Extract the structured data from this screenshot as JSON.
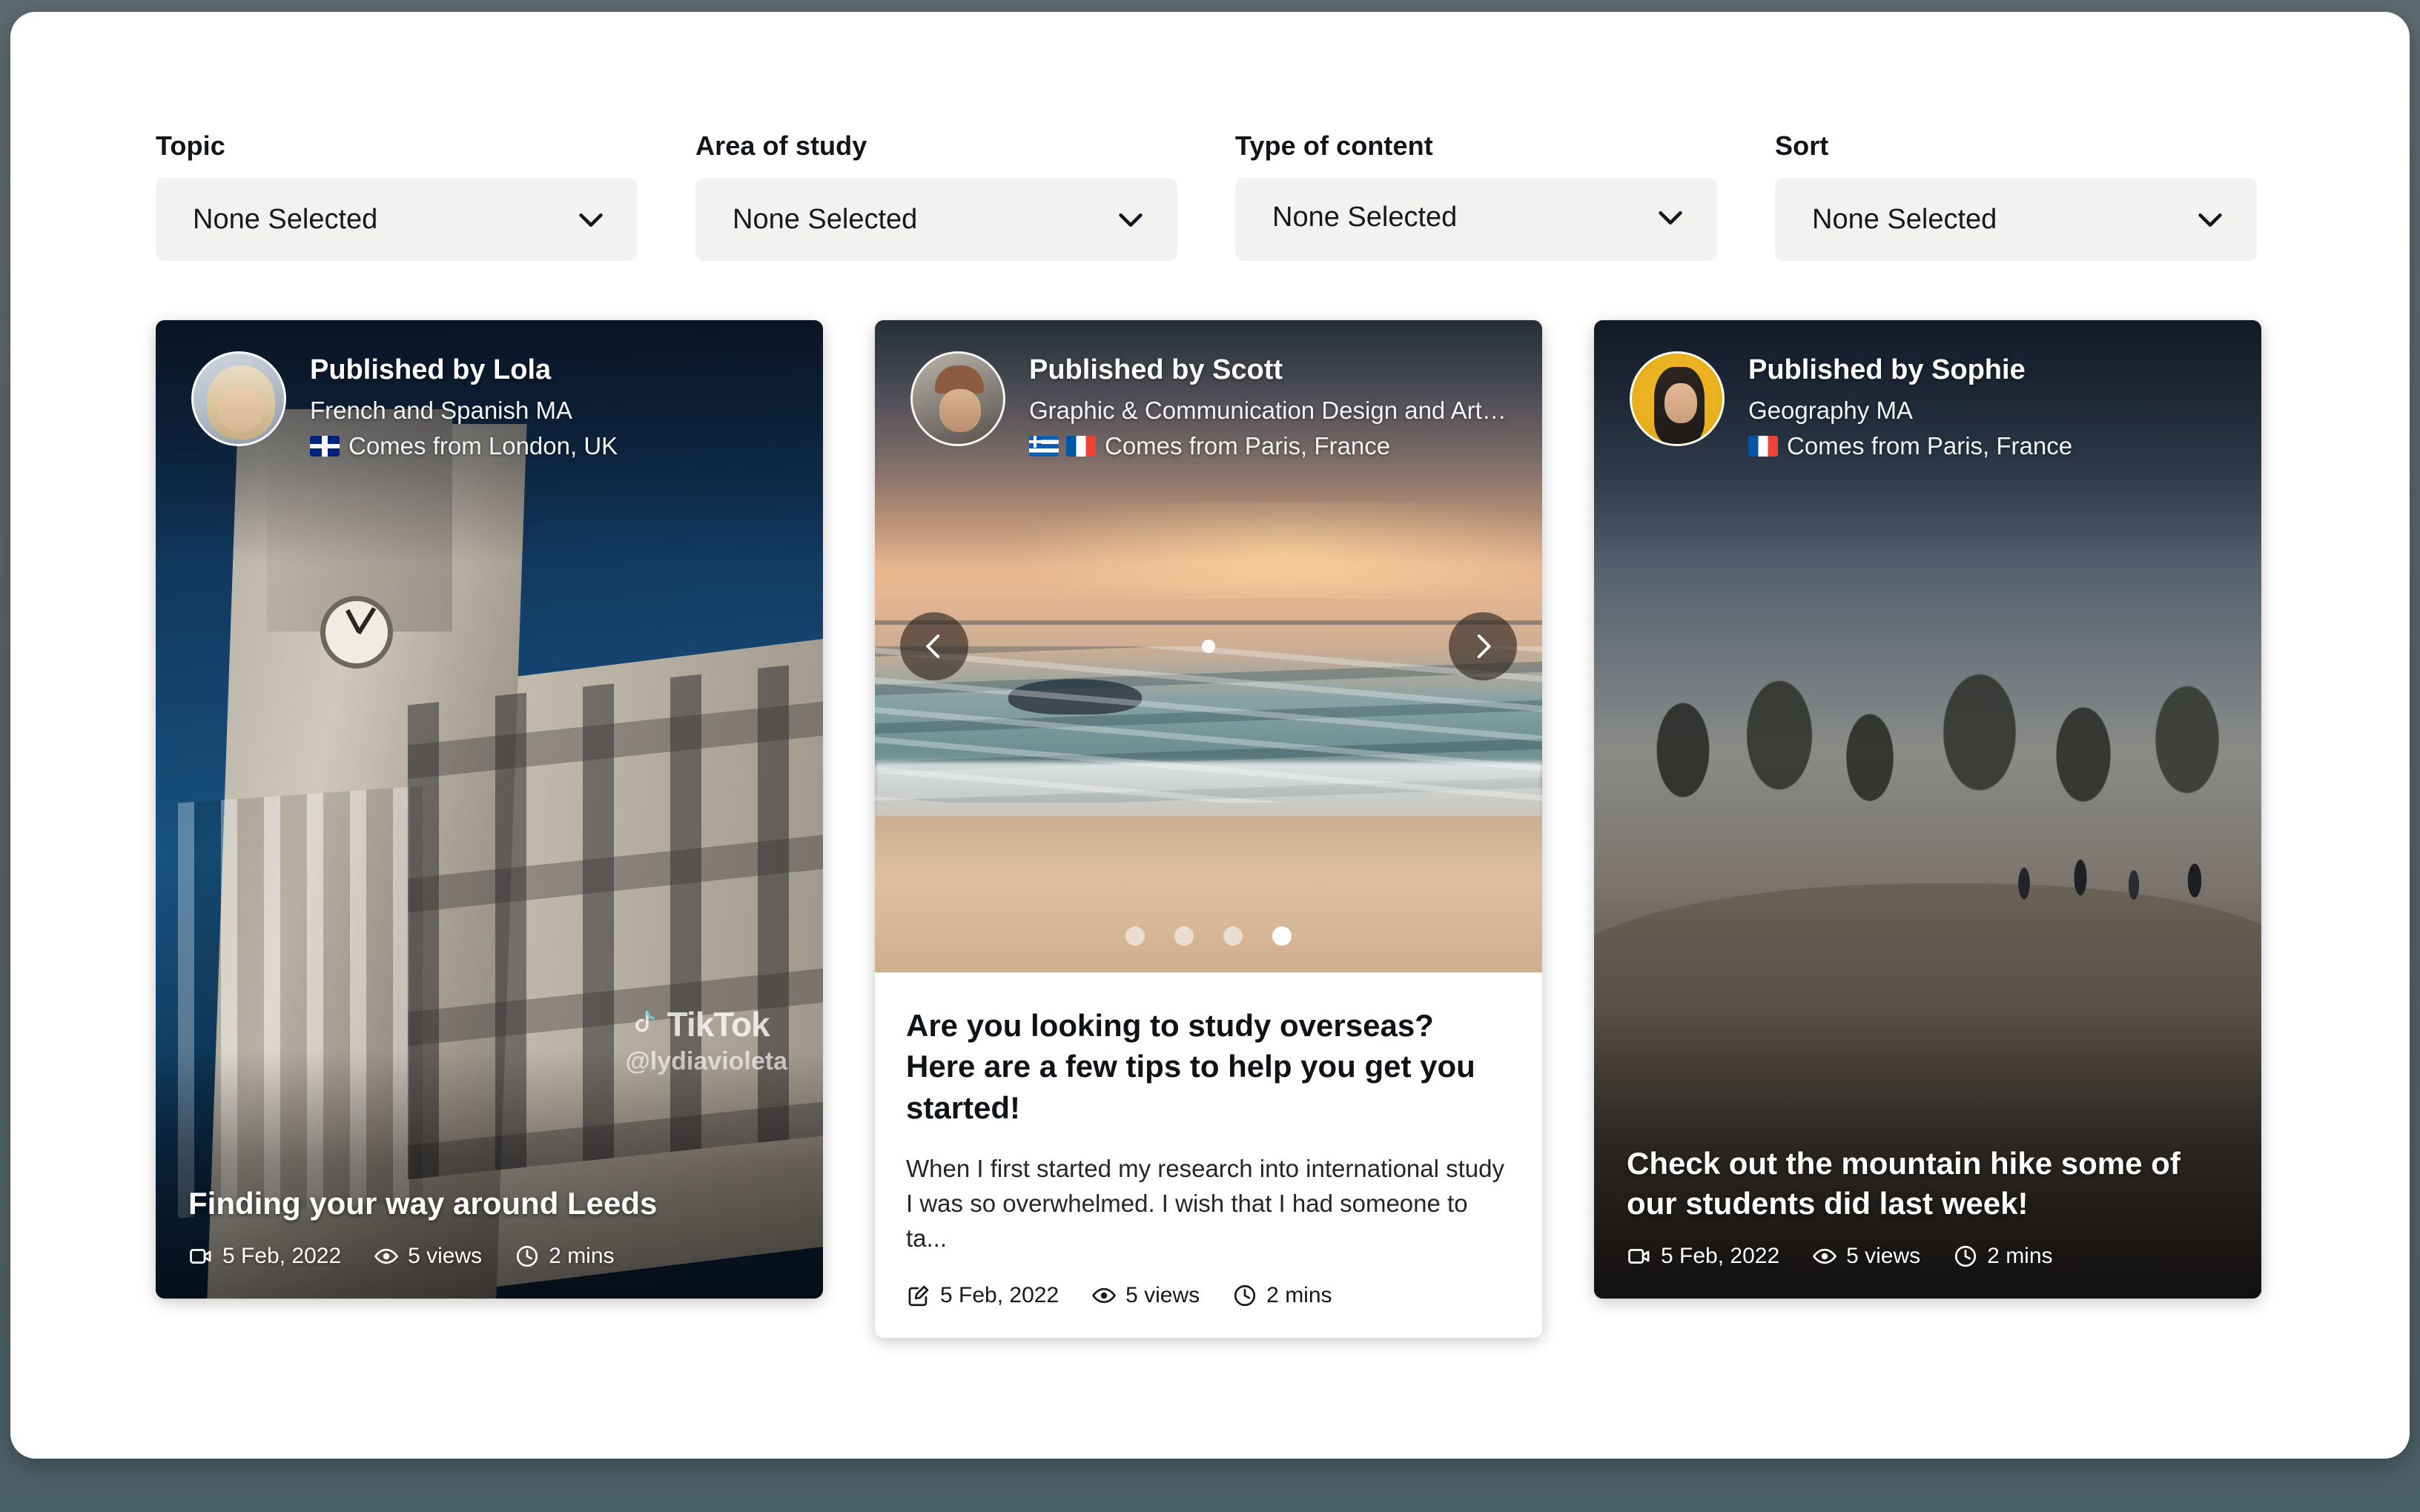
{
  "filters": [
    {
      "label": "Topic",
      "value": "None Selected",
      "icon": "chevron-down-icon"
    },
    {
      "label": "Area of study",
      "value": "None Selected",
      "icon": "chevron-down-icon"
    },
    {
      "label": "Type of content",
      "value": "None Selected",
      "icon": "chevron-down-icon"
    },
    {
      "label": "Sort",
      "value": "None Selected",
      "icon": "chevron-down-icon"
    }
  ],
  "cards": [
    {
      "type": "video",
      "author": {
        "published_by": "Published by Lola",
        "course": "French and Spanish MA",
        "from": "Comes from London, UK",
        "flags": [
          "uk"
        ],
        "avatar": "avatar-lola"
      },
      "title": "Finding your way around Leeds",
      "meta": {
        "date": "5 Feb, 2022",
        "views": "5 views",
        "duration": "2 mins",
        "date_icon": "video-camera-icon",
        "views_icon": "eye-icon",
        "duration_icon": "clock-icon"
      },
      "watermark": {
        "brand": "TikTok",
        "handle": "@lydiavioleta"
      }
    },
    {
      "type": "blog",
      "author": {
        "published_by": "Published by Scott",
        "course": "Graphic & Communication Design and Art…",
        "from": "Comes from Paris, France",
        "flags": [
          "gr",
          "fr"
        ],
        "avatar": "avatar-scott"
      },
      "title": "Are you looking to study overseas? Here are a few tips to help you get you started!",
      "excerpt": "When I first started my research into international study I was so overwhelmed. I wish that I had someone to ta...",
      "meta": {
        "date": "5 Feb, 2022",
        "views": "5 views",
        "duration": "2 mins",
        "date_icon": "edit-pencil-icon",
        "views_icon": "eye-icon",
        "duration_icon": "clock-icon"
      },
      "carousel": {
        "prev_icon": "chevron-left-icon",
        "next_icon": "chevron-right-icon",
        "dots": 4,
        "active_dot": 4
      }
    },
    {
      "type": "video",
      "author": {
        "published_by": "Published by Sophie",
        "course": "Geography MA",
        "from": "Comes from Paris, France",
        "flags": [
          "fr"
        ],
        "avatar": "avatar-sophie"
      },
      "title": "Check out the mountain hike some of our students did last week!",
      "meta": {
        "date": "5 Feb, 2022",
        "views": "5 views",
        "duration": "2 mins",
        "date_icon": "video-camera-icon",
        "views_icon": "eye-icon",
        "duration_icon": "clock-icon"
      }
    }
  ],
  "colors": {
    "page_background": "#ffffff",
    "backdrop": "#4a5d63",
    "filter_field": "#f2f2f1",
    "text_primary": "#111418",
    "text_on_media": "#ffffff"
  }
}
